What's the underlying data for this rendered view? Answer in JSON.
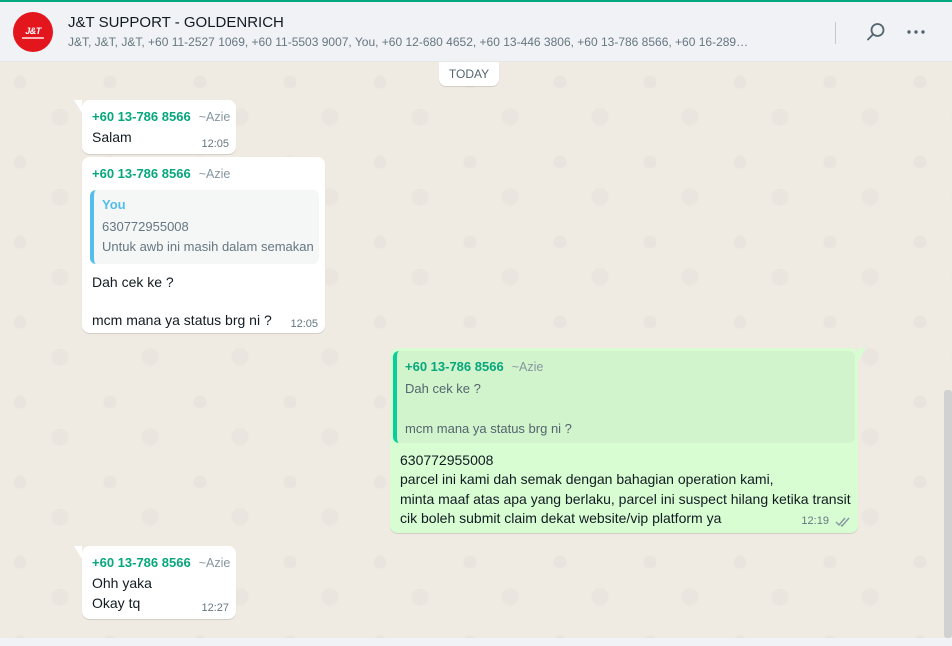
{
  "header": {
    "title": "J&T SUPPORT - GOLDENRICH",
    "participants": "J&T, J&T, J&T, +60 11-2527 1069, +60 11-5503 9007, You, +60 12-680 4652, +60 13-446 3806, +60 13-786 8566, +60 16-289…",
    "avatar_logo": "J&T",
    "search_icon": "search-icon",
    "menu_icon": "more-vertical-icon"
  },
  "chat": {
    "date_chip": "TODAY",
    "messages": [
      {
        "sender_phone": "+60 13-786 8566",
        "sender_alias": "~Azie",
        "text": "Salam",
        "time": "12:05"
      },
      {
        "sender_phone": "+60 13-786 8566",
        "sender_alias": "~Azie",
        "quote": {
          "author": "You",
          "line1": "630772955008",
          "line2": "Untuk awb ini masih dalam semakan"
        },
        "line1": "Dah cek ke ?",
        "line2": "mcm mana ya status brg ni ?",
        "time": "12:05"
      },
      {
        "outgoing": true,
        "quote": {
          "sender_phone": "+60 13-786 8566",
          "sender_alias": "~Azie",
          "line1": "Dah cek ke ?",
          "line2": "mcm mana ya status brg ni ?"
        },
        "line1": "630772955008",
        "line2": "parcel ini kami dah semak dengan bahagian operation kami,",
        "line3": "minta maaf atas apa yang berlaku, parcel ini suspect hilang ketika transit",
        "line4": "cik boleh submit claim dekat website/vip platform ya",
        "time": "12:19",
        "status_icon": "double-check-icon"
      },
      {
        "sender_phone": "+60 13-786 8566",
        "sender_alias": "~Azie",
        "line1": "Ohh yaka",
        "line2": "Okay tq",
        "time": "12:27"
      }
    ]
  },
  "colors": {
    "accent": "#00a884",
    "sender": "#06a77d",
    "outgoing_bubble": "#d9fdd3",
    "quote_bar_blue": "#53bdeb"
  }
}
